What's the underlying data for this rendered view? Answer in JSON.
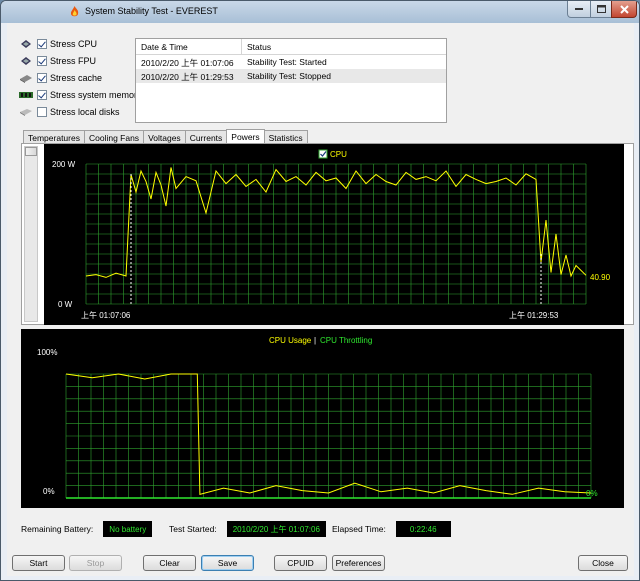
{
  "window": {
    "title": "System Stability Test - EVEREST"
  },
  "options": [
    {
      "label": "Stress CPU",
      "checked": true,
      "icon": "cpu-chip-icon"
    },
    {
      "label": "Stress FPU",
      "checked": true,
      "icon": "fpu-chip-icon"
    },
    {
      "label": "Stress cache",
      "checked": true,
      "icon": "cache-icon"
    },
    {
      "label": "Stress system memory",
      "checked": true,
      "icon": "memory-module-icon"
    },
    {
      "label": "Stress local disks",
      "checked": false,
      "icon": "hard-disk-icon"
    }
  ],
  "log": {
    "headers": [
      "Date & Time",
      "Status"
    ],
    "rows": [
      {
        "datetime": "2010/2/20 上午 01:07:06",
        "status": "Stability Test: Started"
      },
      {
        "datetime": "2010/2/20 上午 01:29:53",
        "status": "Stability Test: Stopped"
      }
    ]
  },
  "tabs": [
    "Temperatures",
    "Cooling Fans",
    "Voltages",
    "Currents",
    "Powers",
    "Statistics"
  ],
  "active_tab": "Powers",
  "power_chart": {
    "legend": "CPU",
    "y_top_label": "200 W",
    "y_bottom_label": "0 W",
    "start_label": "上午 01:07:06",
    "end_label": "上午 01:29:53",
    "current_value": "40.90"
  },
  "usage_chart": {
    "legend_usage": "CPU Usage",
    "legend_sep": "|",
    "legend_throttle": "CPU Throttling",
    "y_top_label": "100%",
    "y_bottom_label": "0%",
    "current_value": "0%"
  },
  "status": {
    "battery_label": "Remaining Battery:",
    "battery_value": "No battery",
    "started_label": "Test Started:",
    "started_value": "2010/2/20 上午 01:07:06",
    "elapsed_label": "Elapsed Time:",
    "elapsed_value": "0:22:46"
  },
  "buttons": {
    "start": "Start",
    "stop": "Stop",
    "clear": "Clear",
    "save": "Save",
    "cpuid": "CPUID",
    "preferences": "Preferences",
    "close": "Close"
  },
  "colors": {
    "graph_bg": "#000000",
    "grid": "#2fa32f",
    "cpu_line": "#ffff00",
    "throttle": "#2fe82f",
    "status_text": "#2fe82f"
  },
  "chart_data": [
    {
      "type": "line",
      "series": [
        {
          "name": "CPU",
          "x": [
            0,
            2,
            4,
            6,
            8,
            9,
            10,
            11,
            12,
            13,
            14,
            15,
            16,
            17,
            18,
            20,
            22,
            24,
            26,
            28,
            30,
            32,
            34,
            36,
            38,
            40,
            42,
            44,
            46,
            48,
            50,
            52,
            54,
            56,
            58,
            60,
            62,
            64,
            66,
            68,
            70,
            72,
            74,
            76,
            78,
            80,
            82,
            84,
            86,
            88,
            90,
            91,
            92,
            93,
            94,
            95,
            96,
            97,
            98,
            100
          ],
          "values": [
            40,
            42,
            38,
            44,
            40,
            185,
            160,
            190,
            175,
            150,
            188,
            170,
            140,
            195,
            165,
            182,
            176,
            130,
            190,
            172,
            185,
            168,
            178,
            160,
            192,
            175,
            182,
            170,
            188,
            176,
            180,
            165,
            190,
            172,
            185,
            175,
            170,
            188,
            178,
            182,
            176,
            190,
            168,
            185,
            178,
            172,
            175,
            180,
            170,
            186,
            178,
            60,
            120,
            45,
            100,
            42,
            70,
            40,
            55,
            41
          ]
        }
      ],
      "ylabel": "",
      "ylim": [
        0,
        200
      ]
    },
    {
      "type": "line",
      "series": [
        {
          "name": "CPU Usage",
          "x": [
            0,
            5,
            10,
            15,
            20,
            25,
            25.5,
            30,
            35,
            40,
            45,
            50,
            55,
            60,
            65,
            70,
            75,
            80,
            85,
            90,
            95,
            100
          ],
          "values": [
            100,
            97,
            100,
            96,
            100,
            100,
            3,
            8,
            4,
            10,
            6,
            4,
            12,
            5,
            8,
            4,
            10,
            6,
            3,
            8,
            5,
            4
          ]
        },
        {
          "name": "CPU Throttling",
          "x": [
            0,
            100
          ],
          "values": [
            0,
            0
          ]
        }
      ],
      "ylim": [
        0,
        100
      ]
    }
  ]
}
